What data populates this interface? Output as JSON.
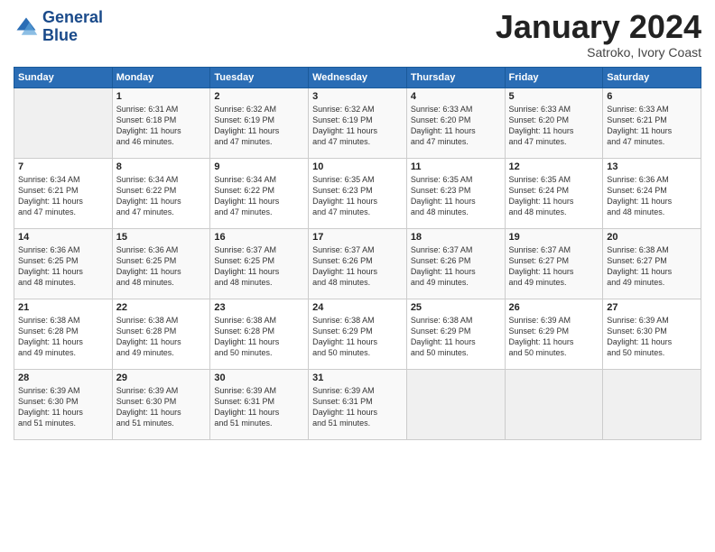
{
  "logo": {
    "line1": "General",
    "line2": "Blue"
  },
  "title": "January 2024",
  "subtitle": "Satroko, Ivory Coast",
  "headers": [
    "Sunday",
    "Monday",
    "Tuesday",
    "Wednesday",
    "Thursday",
    "Friday",
    "Saturday"
  ],
  "weeks": [
    [
      {
        "num": "",
        "detail": ""
      },
      {
        "num": "1",
        "detail": "Sunrise: 6:31 AM\nSunset: 6:18 PM\nDaylight: 11 hours\nand 46 minutes."
      },
      {
        "num": "2",
        "detail": "Sunrise: 6:32 AM\nSunset: 6:19 PM\nDaylight: 11 hours\nand 47 minutes."
      },
      {
        "num": "3",
        "detail": "Sunrise: 6:32 AM\nSunset: 6:19 PM\nDaylight: 11 hours\nand 47 minutes."
      },
      {
        "num": "4",
        "detail": "Sunrise: 6:33 AM\nSunset: 6:20 PM\nDaylight: 11 hours\nand 47 minutes."
      },
      {
        "num": "5",
        "detail": "Sunrise: 6:33 AM\nSunset: 6:20 PM\nDaylight: 11 hours\nand 47 minutes."
      },
      {
        "num": "6",
        "detail": "Sunrise: 6:33 AM\nSunset: 6:21 PM\nDaylight: 11 hours\nand 47 minutes."
      }
    ],
    [
      {
        "num": "7",
        "detail": "Sunrise: 6:34 AM\nSunset: 6:21 PM\nDaylight: 11 hours\nand 47 minutes."
      },
      {
        "num": "8",
        "detail": "Sunrise: 6:34 AM\nSunset: 6:22 PM\nDaylight: 11 hours\nand 47 minutes."
      },
      {
        "num": "9",
        "detail": "Sunrise: 6:34 AM\nSunset: 6:22 PM\nDaylight: 11 hours\nand 47 minutes."
      },
      {
        "num": "10",
        "detail": "Sunrise: 6:35 AM\nSunset: 6:23 PM\nDaylight: 11 hours\nand 47 minutes."
      },
      {
        "num": "11",
        "detail": "Sunrise: 6:35 AM\nSunset: 6:23 PM\nDaylight: 11 hours\nand 48 minutes."
      },
      {
        "num": "12",
        "detail": "Sunrise: 6:35 AM\nSunset: 6:24 PM\nDaylight: 11 hours\nand 48 minutes."
      },
      {
        "num": "13",
        "detail": "Sunrise: 6:36 AM\nSunset: 6:24 PM\nDaylight: 11 hours\nand 48 minutes."
      }
    ],
    [
      {
        "num": "14",
        "detail": "Sunrise: 6:36 AM\nSunset: 6:25 PM\nDaylight: 11 hours\nand 48 minutes."
      },
      {
        "num": "15",
        "detail": "Sunrise: 6:36 AM\nSunset: 6:25 PM\nDaylight: 11 hours\nand 48 minutes."
      },
      {
        "num": "16",
        "detail": "Sunrise: 6:37 AM\nSunset: 6:25 PM\nDaylight: 11 hours\nand 48 minutes."
      },
      {
        "num": "17",
        "detail": "Sunrise: 6:37 AM\nSunset: 6:26 PM\nDaylight: 11 hours\nand 48 minutes."
      },
      {
        "num": "18",
        "detail": "Sunrise: 6:37 AM\nSunset: 6:26 PM\nDaylight: 11 hours\nand 49 minutes."
      },
      {
        "num": "19",
        "detail": "Sunrise: 6:37 AM\nSunset: 6:27 PM\nDaylight: 11 hours\nand 49 minutes."
      },
      {
        "num": "20",
        "detail": "Sunrise: 6:38 AM\nSunset: 6:27 PM\nDaylight: 11 hours\nand 49 minutes."
      }
    ],
    [
      {
        "num": "21",
        "detail": "Sunrise: 6:38 AM\nSunset: 6:28 PM\nDaylight: 11 hours\nand 49 minutes."
      },
      {
        "num": "22",
        "detail": "Sunrise: 6:38 AM\nSunset: 6:28 PM\nDaylight: 11 hours\nand 49 minutes."
      },
      {
        "num": "23",
        "detail": "Sunrise: 6:38 AM\nSunset: 6:28 PM\nDaylight: 11 hours\nand 50 minutes."
      },
      {
        "num": "24",
        "detail": "Sunrise: 6:38 AM\nSunset: 6:29 PM\nDaylight: 11 hours\nand 50 minutes."
      },
      {
        "num": "25",
        "detail": "Sunrise: 6:38 AM\nSunset: 6:29 PM\nDaylight: 11 hours\nand 50 minutes."
      },
      {
        "num": "26",
        "detail": "Sunrise: 6:39 AM\nSunset: 6:29 PM\nDaylight: 11 hours\nand 50 minutes."
      },
      {
        "num": "27",
        "detail": "Sunrise: 6:39 AM\nSunset: 6:30 PM\nDaylight: 11 hours\nand 50 minutes."
      }
    ],
    [
      {
        "num": "28",
        "detail": "Sunrise: 6:39 AM\nSunset: 6:30 PM\nDaylight: 11 hours\nand 51 minutes."
      },
      {
        "num": "29",
        "detail": "Sunrise: 6:39 AM\nSunset: 6:30 PM\nDaylight: 11 hours\nand 51 minutes."
      },
      {
        "num": "30",
        "detail": "Sunrise: 6:39 AM\nSunset: 6:31 PM\nDaylight: 11 hours\nand 51 minutes."
      },
      {
        "num": "31",
        "detail": "Sunrise: 6:39 AM\nSunset: 6:31 PM\nDaylight: 11 hours\nand 51 minutes."
      },
      {
        "num": "",
        "detail": ""
      },
      {
        "num": "",
        "detail": ""
      },
      {
        "num": "",
        "detail": ""
      }
    ]
  ]
}
